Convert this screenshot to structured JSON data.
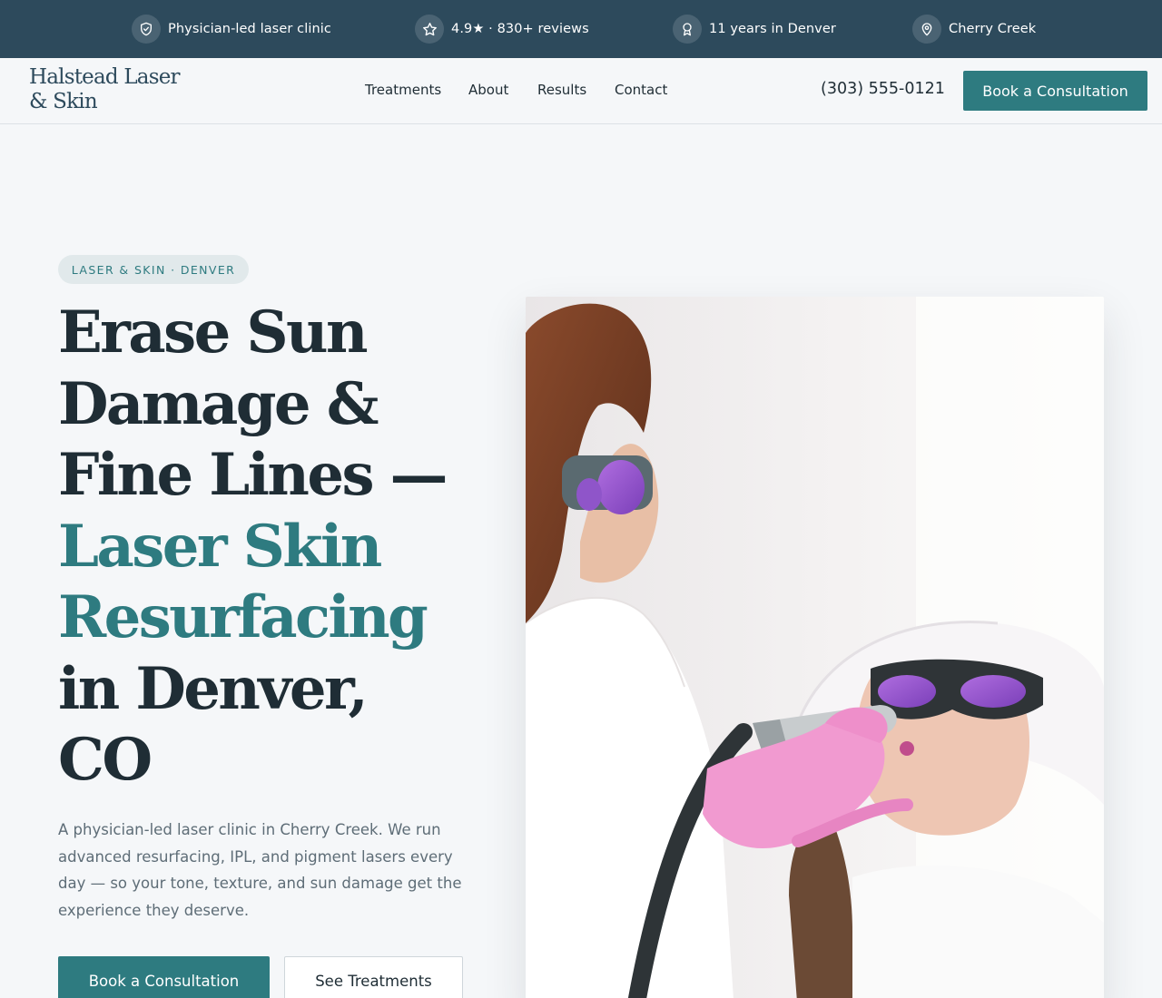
{
  "trust_bar": {
    "items": [
      {
        "icon": "shield-check-icon",
        "text": "Physician-led laser clinic"
      },
      {
        "icon": "star-icon",
        "text": "4.9★ · 830+ reviews"
      },
      {
        "icon": "award-icon",
        "text": "11 years in Denver"
      },
      {
        "icon": "map-pin-icon",
        "text": "Cherry Creek"
      }
    ]
  },
  "header": {
    "logo": "Halstead Laser & Skin",
    "nav": [
      "Treatments",
      "About",
      "Results",
      "Contact"
    ],
    "phone": "(303) 555-0121",
    "cta": "Book a Consultation"
  },
  "hero": {
    "badge": "LASER & SKIN · DENVER",
    "title_lines": [
      "Erase Sun",
      "Damage &",
      "Fine Lines —"
    ],
    "title_accent_lines": [
      "Laser Skin",
      "Resurfacing"
    ],
    "title_tail_lines": [
      "in Denver,",
      "CO"
    ],
    "description": "A physician-led laser clinic in Cherry Creek. We run advanced resurfacing, IPL, and pigment lasers every day — so your tone, texture, and sun damage get the experience they deserve.",
    "primary_cta": "Book a Consultation",
    "secondary_cta": "See Treatments"
  },
  "colors": {
    "topbar": "#2d4a5c",
    "accent": "#2e7b80",
    "background": "#f5f7f9",
    "text": "#1f2d35",
    "muted_text": "#5e6d77"
  }
}
